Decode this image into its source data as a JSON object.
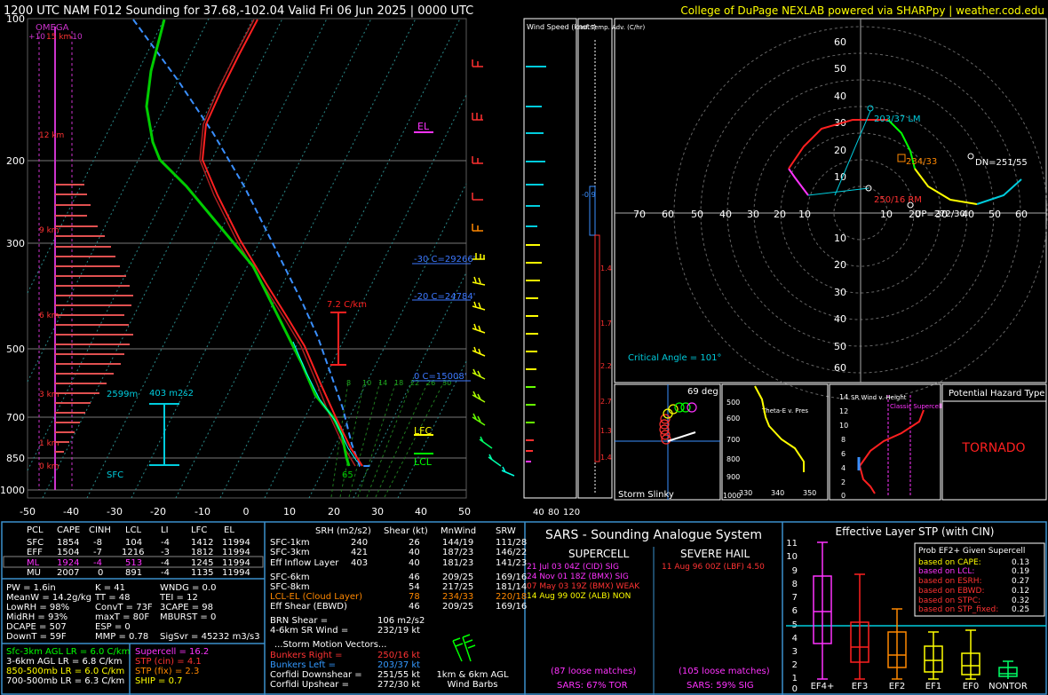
{
  "header": {
    "title": "1200 UTC NAM F012 Sounding for 37.68,-102.04 Valid  Fri 06 Jun 2025 | 0000 UTC",
    "credit": "College of DuPage NEXLAB powered via SHARPpy | weather.cod.edu"
  },
  "skewt": {
    "pressure_labels": [
      "100",
      "200",
      "300",
      "500",
      "700",
      "850",
      "1000"
    ],
    "temp_labels": [
      "-50",
      "-40",
      "-30",
      "-20",
      "-10",
      "0",
      "10",
      "20",
      "30",
      "40",
      "50"
    ],
    "height_labels": [
      "15 km",
      "12 km",
      "9 km",
      "6 km",
      "3 km",
      "1 km",
      "0 km"
    ],
    "omega_label": "OMEGA",
    "omega_scale": [
      "+10",
      "-10"
    ],
    "el_label": "EL",
    "lfc_label": "LFC",
    "lcl_label": "LCL",
    "lapse_label": "7.2 C/km",
    "srh_label": "403 m2s2",
    "pbl_label": "2599m",
    "sfc_label": "SFC",
    "sfc_temp": "65",
    "isotherm_labels": [
      {
        "text": "-30 C=29266'",
        "color": "#3c78ff"
      },
      {
        "text": "-20 C=24784'",
        "color": "#3c78ff"
      },
      {
        "text": "0 C=15008'",
        "color": "#3c78ff"
      }
    ],
    "mixing_ratio_labels": [
      "8",
      "10",
      "14",
      "18",
      "22",
      "26",
      "30"
    ],
    "colors": {
      "temp": "#ff0000",
      "dewpoint": "#00cc00",
      "parcel": "#3a8fff",
      "wetbulb": "#00ffff",
      "isotherm": "#6a6a6a"
    }
  },
  "wind_speed_panel": {
    "title": "Wind Speed (knots)",
    "axis_labels": [
      "40",
      "80",
      "120"
    ]
  },
  "inf_temp_panel": {
    "title": "Inf. Temp. Adv. (C/hr)",
    "values": [
      "-0.9",
      "1.4",
      "1.7",
      "2.2",
      "2.7",
      "1.3",
      "1.4"
    ]
  },
  "hodograph": {
    "ring_labels_y": [
      "60",
      "50",
      "40",
      "30",
      "20",
      "10",
      "10",
      "20",
      "30",
      "40",
      "50",
      "60"
    ],
    "ring_labels_x": [
      "70",
      "60",
      "50",
      "40",
      "30",
      "20",
      "10",
      "10",
      "20",
      "30",
      "40",
      "50",
      "60",
      "70"
    ],
    "lm_label": "203/37 LM",
    "mean_label": "234/33",
    "rm_label": "250/16 RM",
    "dn_label": "DN=251/55",
    "up_label": "UP=272/30",
    "critical_angle": "Critical Angle = 101°"
  },
  "storm_slinky": {
    "angle": "69 deg",
    "label": "Storm Slinky"
  },
  "theta_e": {
    "title": "Theta-E v. Pres",
    "p_labels": [
      "500",
      "600",
      "700",
      "800",
      "900",
      "1000"
    ],
    "x_labels": [
      "330",
      "340",
      "350"
    ]
  },
  "sr_wind": {
    "title": "SR Wind v. Height",
    "supercell_label": "Classic Supercell",
    "y_labels": [
      "14",
      "12",
      "10",
      "8",
      "6",
      "4",
      "2",
      "0"
    ],
    "x_labels": [
      "0",
      "20",
      "40",
      "60",
      "80"
    ]
  },
  "hazard": {
    "title": "Potential Hazard Type",
    "value": "TORNADO"
  },
  "parcels": {
    "headers": [
      "PCL",
      "CAPE",
      "CINH",
      "LCL",
      "LI",
      "LFC",
      "EL"
    ],
    "rows": [
      [
        "SFC",
        "1854",
        "-8",
        "104",
        "-4",
        "1412",
        "11994"
      ],
      [
        "EFF",
        "1504",
        "-7",
        "1216",
        "-3",
        "1812",
        "11994"
      ],
      [
        "ML",
        "1924",
        "-4",
        "513",
        "-4",
        "1245",
        "11994"
      ],
      [
        "MU",
        "2007",
        "0",
        "891",
        "-4",
        "1135",
        "11994"
      ]
    ]
  },
  "thermo": [
    [
      "PW = 1.6in",
      "K = 41",
      "WNDG = 0.0"
    ],
    [
      "MeanW = 14.2g/kg",
      "TT = 48",
      "TEI = 12"
    ],
    [
      "LowRH = 98%",
      "ConvT = 73F",
      "3CAPE = 98"
    ],
    [
      "MidRH = 93%",
      "maxT = 80F",
      "MBURST = 0"
    ],
    [
      "DCAPE = 507",
      "ESP = 0",
      ""
    ],
    [
      "DownT = 59F",
      "MMP = 0.78",
      "SigSvr = 45232 m3/s3"
    ]
  ],
  "lapse_rates": [
    {
      "text": "Sfc-3km AGL LR = 6.0 C/km",
      "color": "#00ff00"
    },
    {
      "text": "3-6km AGL LR = 6.8 C/km",
      "color": "#ffffff"
    },
    {
      "text": "850-500mb LR = 6.0 C/km",
      "color": "#ffff00"
    },
    {
      "text": "700-500mb LR = 6.3 C/km",
      "color": "#ffffff"
    }
  ],
  "composite": [
    {
      "text": "Supercell = 16.2",
      "color": "#ff33ff"
    },
    {
      "text": "STP (cin) = 4.1",
      "color": "#ff3333"
    },
    {
      "text": "STP (fix) = 2.3",
      "color": "#ff8800"
    },
    {
      "text": "SHIP = 0.7",
      "color": "#ffff00"
    }
  ],
  "kinematics": {
    "headers": [
      "SRH (m2/s2)",
      "Shear (kt)",
      "MnWind",
      "SRW"
    ],
    "rows": [
      {
        "label": "SFC-1km",
        "srh": "240",
        "shear": "26",
        "mnwind": "144/19",
        "srw": "111/28",
        "color": "#ffffff"
      },
      {
        "label": "SFC-3km",
        "srh": "421",
        "shear": "40",
        "mnwind": "187/23",
        "srw": "146/22",
        "color": "#ffffff"
      },
      {
        "label": "Eff Inflow Layer",
        "srh": "403",
        "shear": "40",
        "mnwind": "181/23",
        "srw": "141/23",
        "color": "#ffffff"
      },
      {
        "label": "SFC-6km",
        "srh": "",
        "shear": "46",
        "mnwind": "209/25",
        "srw": "169/16",
        "color": "#ffffff"
      },
      {
        "label": "SFC-8km",
        "srh": "",
        "shear": "54",
        "mnwind": "217/25",
        "srw": "181/14",
        "color": "#ffffff"
      },
      {
        "label": "LCL-EL (Cloud Layer)",
        "srh": "",
        "shear": "78",
        "mnwind": "234/33",
        "srw": "220/18",
        "color": "#ff8800"
      },
      {
        "label": "Eff Shear (EBWD)",
        "srh": "",
        "shear": "46",
        "mnwind": "209/25",
        "srw": "169/16",
        "color": "#ffffff"
      }
    ],
    "brn": {
      "label": "BRN Shear =",
      "value": "106 m2/s2"
    },
    "sr_wind": {
      "label": "4-6km SR Wind =",
      "value": "232/19 kt"
    },
    "storm_motion_title": "...Storm Motion Vectors...",
    "vectors": [
      {
        "label": "Bunkers Right =",
        "value": "250/16 kt",
        "color": "#ff3333"
      },
      {
        "label": "Bunkers Left =",
        "value": "203/37 kt",
        "color": "#3399ff"
      },
      {
        "label": "Corfidi Downshear =",
        "value": "251/55 kt",
        "color": "#ffffff"
      },
      {
        "label": "Corfidi Upshear =",
        "value": "272/30 kt",
        "color": "#ffffff"
      }
    ],
    "barb_caption": [
      "1km & 6km AGL",
      "Wind Barbs"
    ]
  },
  "sars": {
    "title": "SARS - Sounding Analogue System",
    "supercell_title": "SUPERCELL",
    "hail_title": "SEVERE HAIL",
    "supercell_matches": [
      {
        "text": "21 Jul 03 04Z (CID)   SIG",
        "color": "#ff33ff"
      },
      {
        "text": "24 Nov 01 18Z (BMX) SIG",
        "color": "#ff33ff"
      },
      {
        "text": "07 May 03 19Z (BMX) WEAK",
        "color": "#ff3333"
      },
      {
        "text": "14 Aug 99 00Z (ALB)   NON",
        "color": "#ffff00"
      }
    ],
    "hail_matches": [
      {
        "text": "11 Aug 96 00Z (LBF)   4.50",
        "color": "#ff3333"
      }
    ],
    "supercell_loose": "(87 loose matches)",
    "supercell_pct": "SARS: 67% TOR",
    "hail_loose": "(105 loose matches)",
    "hail_pct": "SARS: 59% SIG"
  },
  "stp": {
    "title": "Effective Layer STP (with CIN)",
    "y_labels": [
      "11",
      "10",
      "9",
      "8",
      "7",
      "6",
      "5",
      "4",
      "3",
      "2",
      "1",
      "0"
    ],
    "categories": [
      "EF4+",
      "EF3",
      "EF2",
      "EF1",
      "EF0",
      "NONTOR"
    ],
    "prob_title": "Prob EF2+ Given Supercell",
    "probs": [
      {
        "label": "based on CAPE:",
        "value": "0.13"
      },
      {
        "label": "based on LCL:",
        "value": "0.19"
      },
      {
        "label": "based on ESRH:",
        "value": "0.27"
      },
      {
        "label": "based on EBWD:",
        "value": "0.12"
      },
      {
        "label": "based on STPC:",
        "value": "0.32"
      },
      {
        "label": "based on STP_fixed:",
        "value": "0.25"
      }
    ]
  }
}
